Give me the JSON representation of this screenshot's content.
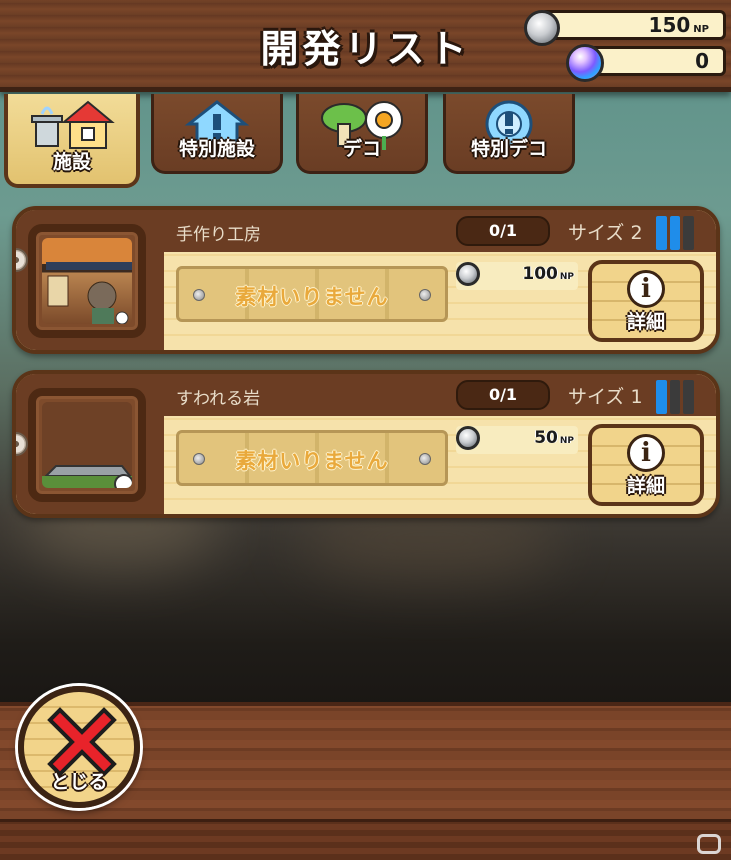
{
  "header": {
    "title": "開発リスト",
    "coins": {
      "amount": "150",
      "unit": "NP"
    },
    "orbs": {
      "amount": "0"
    }
  },
  "tabs": [
    {
      "label": "施設",
      "icon": "house-fountain-icon",
      "active": true
    },
    {
      "label": "特別施設",
      "icon": "special-house-icon",
      "active": false
    },
    {
      "label": "デコ",
      "icon": "mushroom-flower-icon",
      "active": false
    },
    {
      "label": "特別デコ",
      "icon": "special-deco-icon",
      "active": false
    }
  ],
  "items": [
    {
      "name": "手作り工房",
      "count": "0/1",
      "size_label": "サイズ 2",
      "size": 2,
      "materials_text": "素材いりません",
      "cost": "100",
      "cost_unit": "NP",
      "detail_label": "詳細"
    },
    {
      "name": "すわれる岩",
      "count": "0/1",
      "size_label": "サイズ 1",
      "size": 1,
      "materials_text": "素材いりません",
      "cost": "50",
      "cost_unit": "NP",
      "detail_label": "詳細"
    }
  ],
  "footer": {
    "close_label": "とじる"
  },
  "colors": {
    "wood_dark": "#6b3d23",
    "panel": "#f4dda0",
    "size_on": "#1f8dea",
    "close_red": "#e8232a"
  }
}
